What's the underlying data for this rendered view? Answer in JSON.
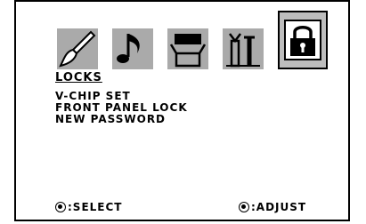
{
  "tabs": [
    {
      "icon": "brush-icon",
      "selected": false
    },
    {
      "icon": "music-note-icon",
      "selected": false
    },
    {
      "icon": "tv-box-icon",
      "selected": false
    },
    {
      "icon": "tools-icon",
      "selected": false
    },
    {
      "icon": "lock-icon",
      "selected": true
    }
  ],
  "section_title": "LOCKS",
  "menu_items": [
    "V-CHIP SET",
    "FRONT PANEL LOCK",
    "NEW PASSWORD"
  ],
  "footer": {
    "select_label": ":SELECT",
    "adjust_label": ":ADJUST"
  },
  "colors": {
    "tab_background": "#aaaaaa",
    "selected_tab_background": "#bdbdbd",
    "text": "#000000"
  }
}
